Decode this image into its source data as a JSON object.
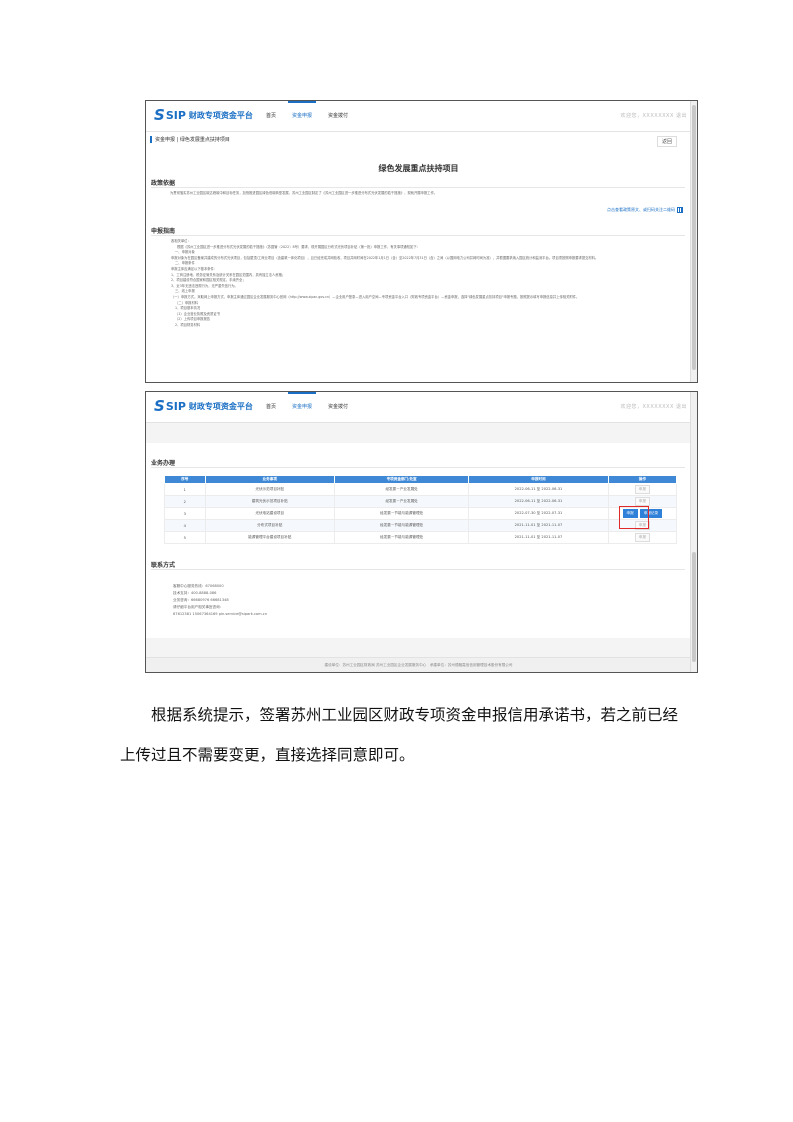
{
  "header": {
    "logo_text": "SIP",
    "brand_name": "财政专项资金平台",
    "nav": [
      "首页",
      "资金申报",
      "资金拨付"
    ],
    "user_info": "欢迎您，XXXXXXXX  退出"
  },
  "shot1": {
    "breadcrumb": "资金申报 | 绿色发展重点扶持项目",
    "back_label": "返回",
    "page_title": "绿色发展重点扶持项目",
    "policy_title": "政策依据",
    "policy_text": "为贯彻落实苏州工业园区碳达峰碳中和目标任务，加快推进园区绿色低碳转型发展，苏州工业园区制定了《苏州工业园区进一步推进分布式光伏发展的若干措施》，现就开展申报工作。",
    "policy_link": "点击查看政策原文、或扫码关注二维码",
    "guide_title": "申报指南",
    "guide_lines": [
      "各相关单位：",
      "根据《苏州工业园区进一步推进分布式光伏发展的若干措施》（苏园管〔2022〕8号）要求，现开展园区分布式光伏项目补贴（第一批）申报工作，有关事项通知如下：",
      "一、申报对象",
      "申报对象为在园区备案并建成的分布式光伏项目，包括屋顶/工商业项目（含建筑一体化项目），且已经完成并网验收，项目并网时间在2022年1月1日（含）至2022年7月31日（含）之间（以国网电力公司并网时间为准），并根据要求纳入园区统计和监测平台。项目须按照申报要求提交材料。",
      "二、申报条件",
      "申报主体应满足以下基本条件：",
      "1、工商注册地、税务征管关系及统计关系在园区范围内，具有独立法人资格；",
      "2、项目建设符合国家和园区相关规定，手续齐全；",
      "3、近3年无违法违规行为，无严重失信行为。",
      "三、线上申报",
      "（一）申报方式。采取网上申报方式，申报主体通过园区企业发展服务中心官网（http://www.sipac.gov.cn）—企业用户登录—进入用户空间—专项资金平台入口（财政专项资金平台）—资金申报，选择\"绿色发展重点扶持项目\"申报专题，按照提示填写申报信息并上传相关附件。",
      "（二）申报材料",
      "1、项目基本情况",
      "（1）企业营业执照及资质证书",
      "（2）上传项目申报报告",
      "2、项目财务材料"
    ]
  },
  "shot2": {
    "business_title": "业务办理",
    "table_headers": [
      "序号",
      "业务事项",
      "专项资金部门/处室",
      "申报时间",
      "操作"
    ],
    "rows": [
      {
        "no": "1",
        "item": "光伏示范项目补贴",
        "dept": "经发委－产业发展处",
        "time": "2022-06-11 至 2022-06-31",
        "actions": [
          "申报"
        ]
      },
      {
        "no": "2",
        "item": "建筑光伏示范项目补贴",
        "dept": "经发委－产业发展处",
        "time": "2022-06-11 至 2022-06-31",
        "actions": [
          "申报"
        ]
      },
      {
        "no": "3",
        "item": "光伏电站建设项目",
        "dept": "经发委－节能与能源管理处",
        "time": "2022-07-30 至 2022-07-31",
        "actions": [
          "申报",
          "申报记录"
        ]
      },
      {
        "no": "4",
        "item": "分布式项目补贴",
        "dept": "经发委－节能与能源管理处",
        "time": "2021-11-01 至 2021-11-07",
        "actions": [
          "申报"
        ]
      },
      {
        "no": "5",
        "item": "能源管理平台建设项目补贴",
        "dept": "经发委－节能与能源管理处",
        "time": "2021-11-01 至 2021-11-07",
        "actions": [
          "申报"
        ]
      }
    ],
    "contact_title": "联系方式",
    "contact_lines": [
      "客服中心服务热线：67068000",
      "技术支持：400-8888-086",
      "业务咨询：66680976 66681348",
      "请仔细平台用户相关事宜咨询：",
      "67612381 15067364169 pln.service@sipark.com.cn"
    ],
    "footer_text": "建设单位：苏州工业园区财政局 苏州工业园区企业发展服务中心　承建单位：苏州德融嘉信信用管理技术股份有限公司"
  },
  "caption": "根据系统提示，签署苏州工业园区财政专项资金申报信用承诺书，若之前已经上传过且不需要变更，直接选择同意即可。",
  "colors": {
    "brand_blue": "#1a6fc4",
    "table_header": "#3e88d6",
    "highlight_red": "#e02a2a"
  }
}
